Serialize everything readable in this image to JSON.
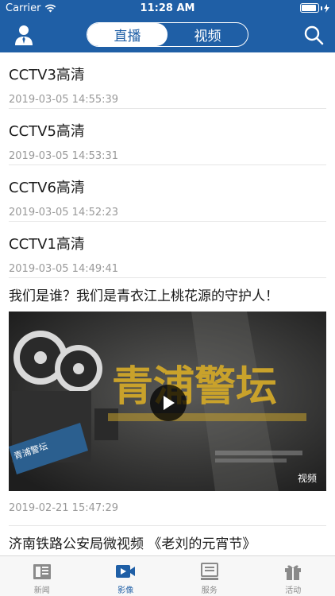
{
  "status_bar": {
    "carrier": "Carrier",
    "time": "11:28 AM",
    "battery_level": 0.9
  },
  "navbar": {
    "segments": [
      {
        "label": "直播",
        "active": true
      },
      {
        "label": "视频",
        "active": false
      }
    ],
    "user_icon": "user-icon",
    "search_icon": "search-icon"
  },
  "live_items": [
    {
      "title": "CCTV3高清",
      "time": "2019-03-05  14:55:39"
    },
    {
      "title": "CCTV5高清",
      "time": "2019-03-05  14:53:31"
    },
    {
      "title": "CCTV6高清",
      "time": "2019-03-05  14:52:23"
    },
    {
      "title": "CCTV1高清",
      "time": "2019-03-05  14:49:41"
    }
  ],
  "video": {
    "title": "我们是谁？我们是青衣江上桃花源的守护人！",
    "thumbnail_text": "青浦警坛",
    "tag": "视频",
    "time": "2019-02-21  15:47:29"
  },
  "next_video_title": "济南铁路公安局微视频 《老刘的元宵节》",
  "tabbar": [
    {
      "label": "新闻",
      "icon": "news-icon",
      "active": false
    },
    {
      "label": "影像",
      "icon": "video-camera-icon",
      "active": true
    },
    {
      "label": "服务",
      "icon": "service-icon",
      "active": false
    },
    {
      "label": "活动",
      "icon": "gift-icon",
      "active": false
    }
  ],
  "colors": {
    "brand": "#1f5fa6",
    "secondary_text": "#999999",
    "divider": "#e6e6e6"
  }
}
